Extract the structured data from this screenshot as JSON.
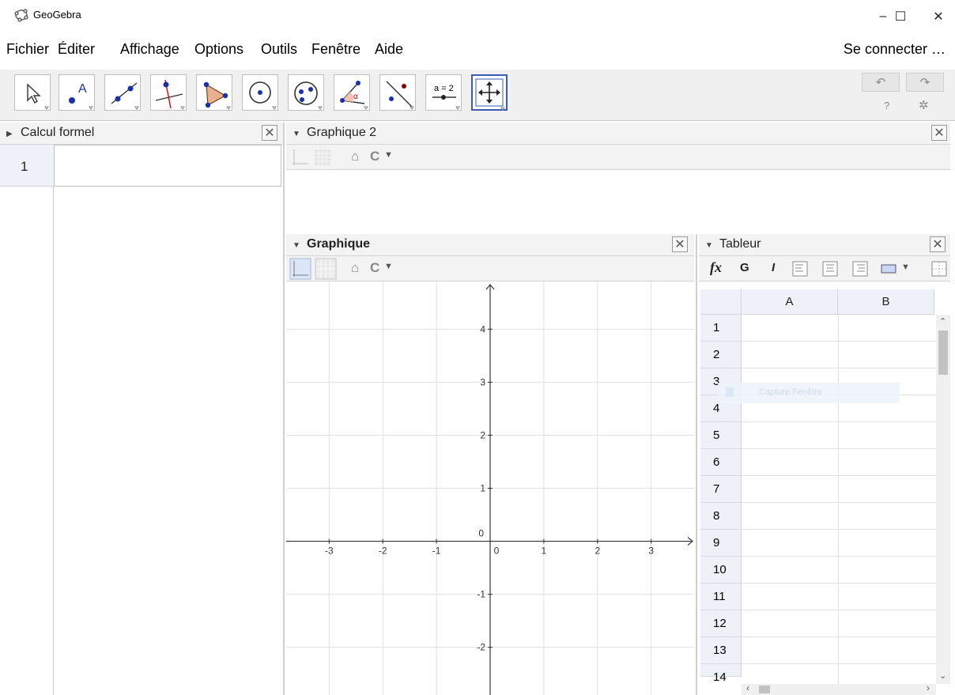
{
  "window": {
    "title": "GeoGebra",
    "minimize_glyph": "–",
    "maximize_glyph": "☐",
    "close_glyph": "✕"
  },
  "menu": {
    "items": [
      "Fichier",
      "Éditer",
      "Affichage",
      "Options",
      "Outils",
      "Fenêtre",
      "Aide"
    ],
    "signin": "Se connecter …"
  },
  "toolbar": {
    "tools": [
      {
        "name": "move",
        "icon": "arrow-cursor-icon"
      },
      {
        "name": "point",
        "icon": "point-icon",
        "label": "A"
      },
      {
        "name": "line",
        "icon": "line-through-points-icon"
      },
      {
        "name": "perpendicular",
        "icon": "perpendicular-line-icon"
      },
      {
        "name": "polygon",
        "icon": "polygon-icon"
      },
      {
        "name": "circle",
        "icon": "circle-center-point-icon"
      },
      {
        "name": "conic",
        "icon": "ellipse-icon"
      },
      {
        "name": "angle",
        "icon": "angle-icon",
        "label": "α"
      },
      {
        "name": "reflect",
        "icon": "reflect-about-line-icon"
      },
      {
        "name": "slider",
        "icon": "slider-icon",
        "label": "a = 2"
      },
      {
        "name": "move-graphics",
        "icon": "move-graphics-view-icon",
        "selected": true
      }
    ],
    "undo_icon": "undo-icon",
    "redo_icon": "redo-icon",
    "help_icon": "help-icon",
    "settings_icon": "gear-icon"
  },
  "cas": {
    "title": "Calcul formel",
    "rows": [
      "1"
    ]
  },
  "graphics2": {
    "title": "Graphique 2"
  },
  "graphics": {
    "title": "Graphique",
    "x_ticks": [
      "-3",
      "-2",
      "-1",
      "0",
      "1",
      "2",
      "3"
    ],
    "y_ticks": [
      "4",
      "3",
      "2",
      "1",
      "-1",
      "-2"
    ],
    "x_range": [
      -3.8,
      3.8
    ],
    "y_range": [
      -2.9,
      4.9
    ]
  },
  "spreadsheet": {
    "title": "Tableur",
    "fx_label": "fx",
    "bold_label": "G",
    "italic_label": "I",
    "columns": [
      "A",
      "B"
    ],
    "rows": [
      "1",
      "2",
      "3",
      "4",
      "5",
      "6",
      "7",
      "8",
      "9",
      "10",
      "11",
      "12",
      "13",
      "14"
    ],
    "ghost_text": "Capture Fenêtre"
  },
  "colors": {
    "selection": "#3a5bb0",
    "point_blue": "#1b2fa8",
    "grid": "#e0e0e0",
    "header_bg": "#eef1f7"
  }
}
